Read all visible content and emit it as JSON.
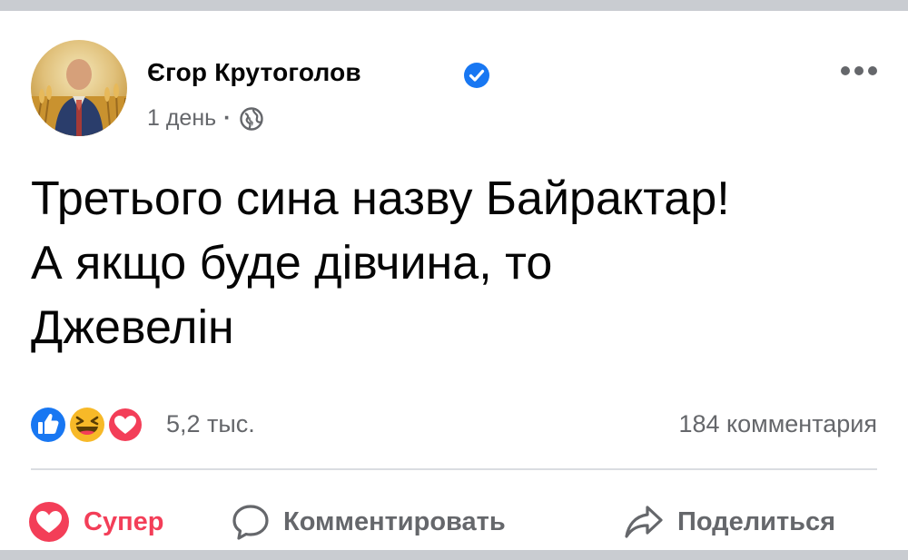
{
  "post": {
    "author": "Єгор Крутоголов",
    "verified": true,
    "time": "1 день",
    "separator": "·",
    "audience_icon": "globe-icon",
    "text_lines": [
      "Третього сина назву Байрактар!",
      "А якщо буде дівчина, то",
      "Джевелін"
    ]
  },
  "reactions": {
    "icons": [
      "like-icon",
      "haha-icon",
      "love-icon"
    ],
    "count": "5,2 тыс.",
    "comments": "184 комментария"
  },
  "actions": {
    "super_label": "Супер",
    "comment_label": "Комментировать",
    "share_label": "Поделиться"
  },
  "colors": {
    "verified": "#1877f2",
    "like": "#1877f2",
    "love": "#f33e58",
    "haha": "#f7b928",
    "secondary_text": "#65676b",
    "divider": "#dadde1"
  }
}
